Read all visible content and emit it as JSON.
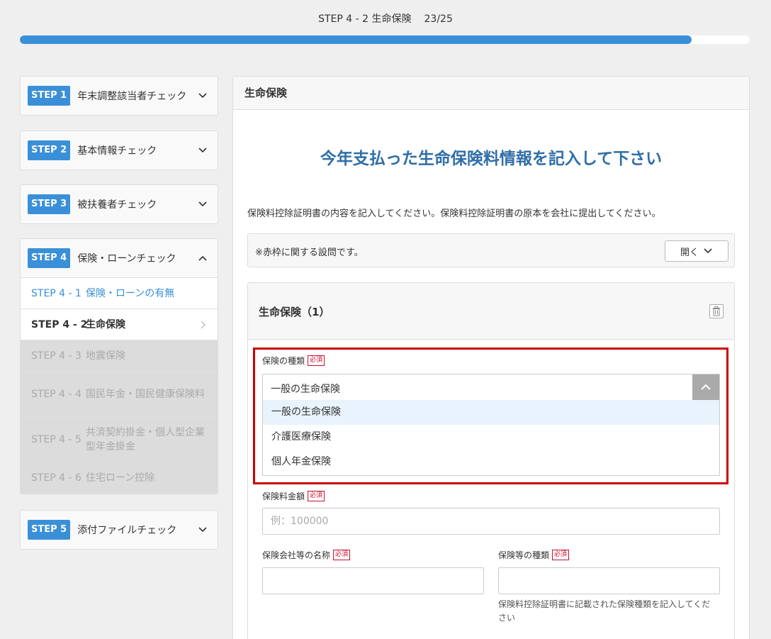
{
  "header": {
    "step_title": "STEP 4 - 2 生命保険",
    "counter": "23/25",
    "progress": 0.92
  },
  "sidebar": {
    "steps": [
      {
        "badge": "STEP 1",
        "label": "年末調整該当者チェック"
      },
      {
        "badge": "STEP 2",
        "label": "基本情報チェック"
      },
      {
        "badge": "STEP 3",
        "label": "被扶養者チェック"
      },
      {
        "badge": "STEP 4",
        "label": "保険・ローンチェック"
      },
      {
        "badge": "STEP 5",
        "label": "添付ファイルチェック"
      }
    ],
    "substeps": [
      {
        "code": "STEP 4 - 1",
        "label": "保険・ローンの有無"
      },
      {
        "code": "STEP 4 - 2",
        "label": "生命保険"
      },
      {
        "code": "STEP 4 - 3",
        "label": "地震保険"
      },
      {
        "code": "STEP 4 - 4",
        "label": "国民年金・国民健康保険料"
      },
      {
        "code": "STEP 4 - 5",
        "label": "共済契約掛金・個人型企業型年金掛金"
      },
      {
        "code": "STEP 4 - 6",
        "label": "住宅ローン控除"
      }
    ]
  },
  "main": {
    "panel_title": "生命保険",
    "headline": "今年支払った生命保険料情報を記入して下さい",
    "description": "保険料控除証明書の内容を記入してください。保険料控除証明書の原本を会社に提出してください。",
    "note": "※赤枠に関する設問です。",
    "open_button": "開く",
    "card_title": "生命保険（1）",
    "required_label": "必須",
    "insurance_type": {
      "label": "保険の種類",
      "value": "一般の生命保険",
      "options": [
        "一般の生命保険",
        "介護医療保険",
        "個人年金保険"
      ]
    },
    "premium": {
      "label": "保険料金額",
      "placeholder": "例：100000"
    },
    "company": {
      "label": "保険会社等の名称"
    },
    "kind": {
      "label": "保険等の種類",
      "help": "保険料控除証明書に記載された保険種類を記入してください"
    }
  },
  "colors": {
    "accent": "#3a90d8",
    "headline": "#2f6ea8",
    "required": "#c8102e",
    "frame": "#cc0000"
  }
}
